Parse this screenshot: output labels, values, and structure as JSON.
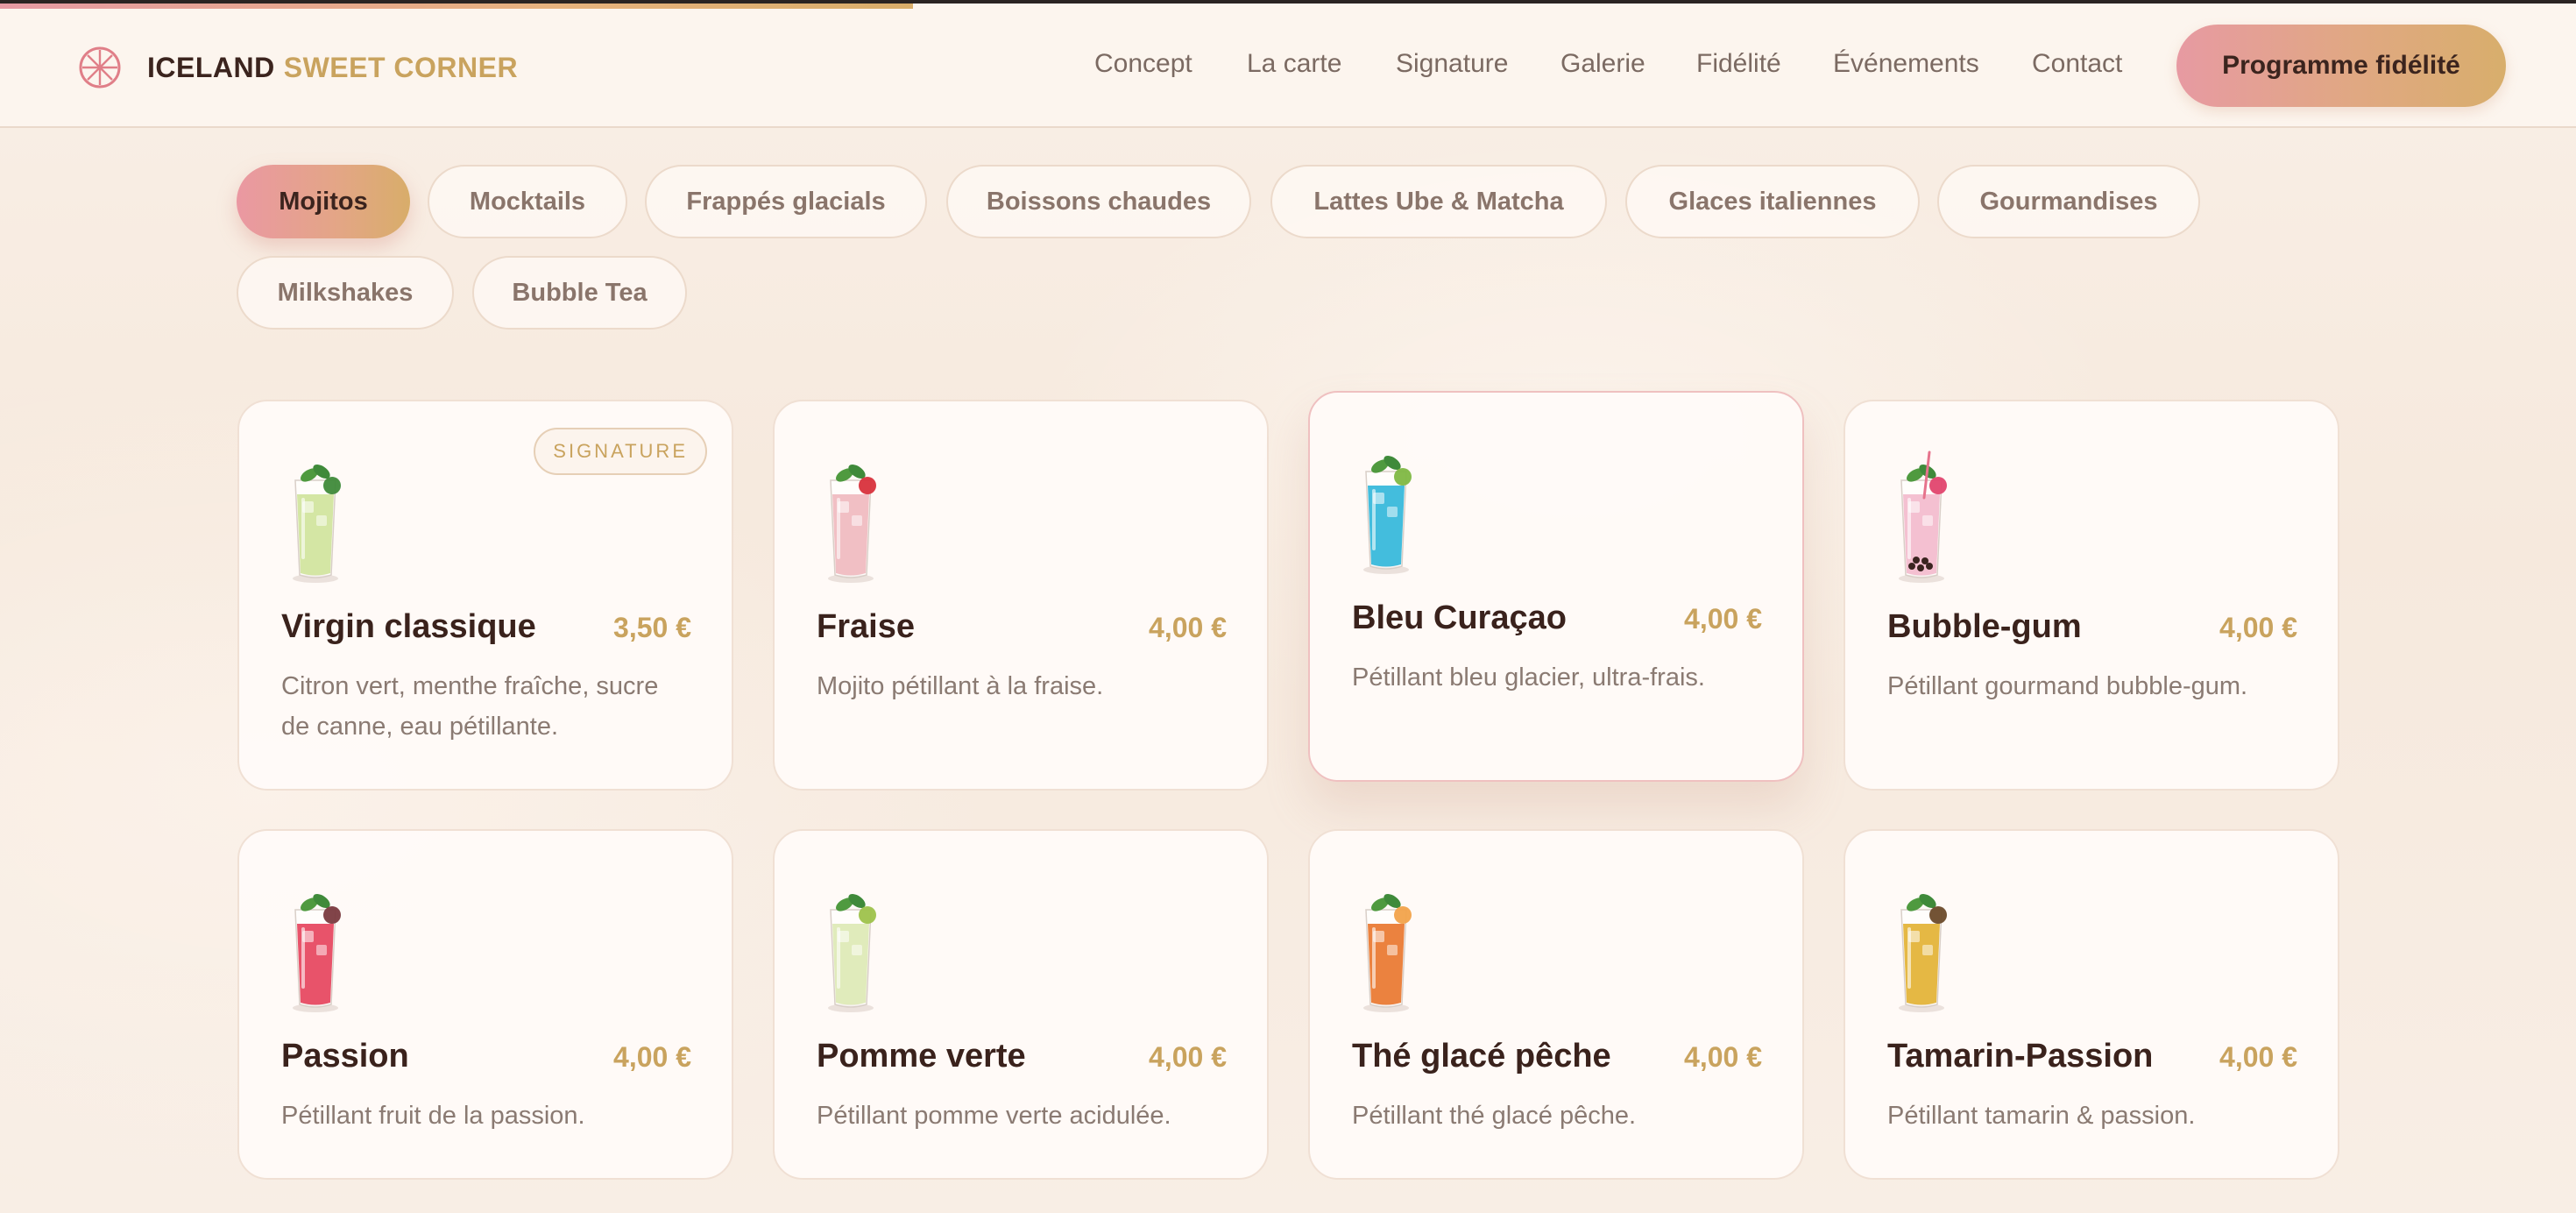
{
  "brand": {
    "part1": "ICELAND",
    "part2": "SWEET CORNER",
    "logo_icon": "citrus-slice-icon"
  },
  "nav": {
    "links": [
      "Concept",
      "La carte",
      "Signature",
      "Galerie",
      "Fidélité",
      "Événements",
      "Contact"
    ],
    "cta": "Programme fidélité"
  },
  "categories": [
    {
      "label": "Mojitos",
      "active": true
    },
    {
      "label": "Mocktails",
      "active": false
    },
    {
      "label": "Frappés glacials",
      "active": false
    },
    {
      "label": "Boissons chaudes",
      "active": false
    },
    {
      "label": "Lattes Ube & Matcha",
      "active": false
    },
    {
      "label": "Glaces italiennes",
      "active": false
    },
    {
      "label": "Gourmandises",
      "active": false
    },
    {
      "label": "Milkshakes",
      "active": false
    },
    {
      "label": "Bubble Tea",
      "active": false
    }
  ],
  "products": [
    {
      "name": "Virgin classique",
      "price": "3,50 €",
      "description": "Citron vert, menthe fraîche, sucre de canne, eau pétillante.",
      "badge": "SIGNATURE",
      "icon": "green-mojito-glass-icon",
      "liquid": "#cfe39a",
      "garnish": "#3f8a3a"
    },
    {
      "name": "Fraise",
      "price": "4,00 €",
      "description": "Mojito pétillant à la fraise.",
      "badge": "",
      "icon": "strawberry-mojito-glass-icon",
      "liquid": "#f0b8be",
      "garnish": "#d8323c"
    },
    {
      "name": "Bleu Curaçao",
      "price": "4,00 €",
      "description": "Pétillant bleu glacier, ultra-frais.",
      "badge": "",
      "icon": "blue-curacao-glass-icon",
      "liquid": "#2fb6d9",
      "garnish": "#7fb843"
    },
    {
      "name": "Bubble-gum",
      "price": "4,00 €",
      "description": "Pétillant gourmand bubble-gum.",
      "badge": "",
      "icon": "bubble-gum-glass-icon",
      "liquid": "#f3b9cc",
      "garnish": "#e2456e"
    },
    {
      "name": "Passion",
      "price": "4,00 €",
      "description": "Pétillant fruit de la passion.",
      "badge": "",
      "icon": "passion-fruit-glass-icon",
      "liquid": "#e6405a",
      "garnish": "#7a3a3f"
    },
    {
      "name": "Pomme verte",
      "price": "4,00 €",
      "description": "Pétillant pomme verte acidulée.",
      "badge": "",
      "icon": "green-apple-glass-icon",
      "liquid": "#dde9b4",
      "garnish": "#9ec24b"
    },
    {
      "name": "Thé glacé pêche",
      "price": "4,00 €",
      "description": "Pétillant thé glacé pêche.",
      "badge": "",
      "icon": "peach-iced-tea-glass-icon",
      "liquid": "#e9742a",
      "garnish": "#f2a34b"
    },
    {
      "name": "Tamarin-Passion",
      "price": "4,00 €",
      "description": "Pétillant tamarin & passion.",
      "badge": "",
      "icon": "tamarind-passion-glass-icon",
      "liquid": "#e2b030",
      "garnish": "#6b4a2a"
    }
  ]
}
